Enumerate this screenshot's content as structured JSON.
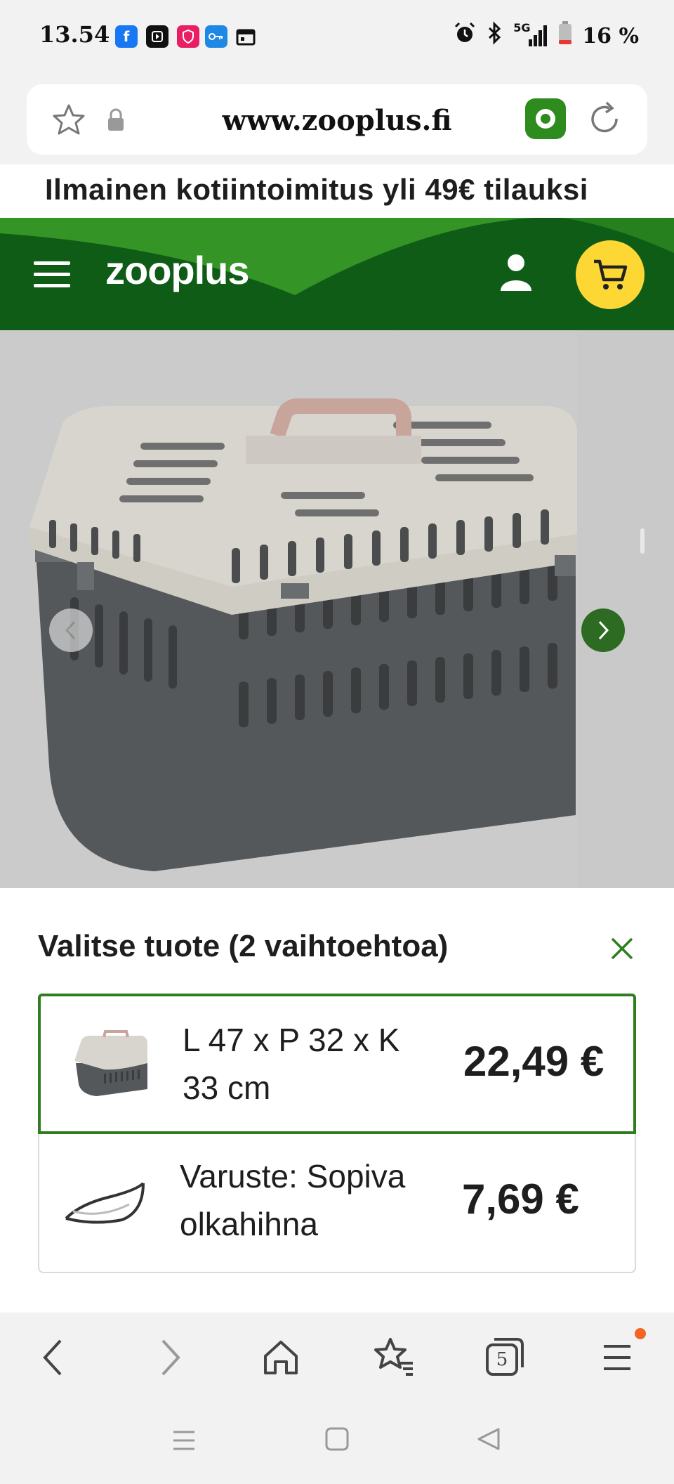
{
  "status_bar": {
    "time": "13.54",
    "network": "5G",
    "battery": "16 %",
    "notification_icons": [
      "facebook-icon",
      "play-icon",
      "shield-icon",
      "key-icon",
      "calendar-icon"
    ],
    "system_icons": [
      "alarm-icon",
      "bluetooth-icon",
      "signal-icon",
      "battery-icon"
    ]
  },
  "browser": {
    "url": "www.zooplus.fi",
    "tab_count": "5"
  },
  "promo": {
    "text": "Ilmainen kotiintoimitus yli 49€ tilauksi"
  },
  "header": {
    "logo": "zooplus",
    "brand_green": "#0f5c17",
    "cart_color": "#fdd835"
  },
  "sheet": {
    "title": "Valitse tuote (2 vaihtoehtoa)",
    "options": [
      {
        "label_line1": "L 47 x P 32 x K",
        "label_line2": "33 cm",
        "price": "22,49 €",
        "selected": true
      },
      {
        "label_line1": "Varuste: Sopiva",
        "label_line2": "olkahihna",
        "price": "7,69 €",
        "selected": false
      }
    ]
  },
  "colors": {
    "accent_green": "#2e7d1f",
    "notification_dot": "#f26522"
  }
}
